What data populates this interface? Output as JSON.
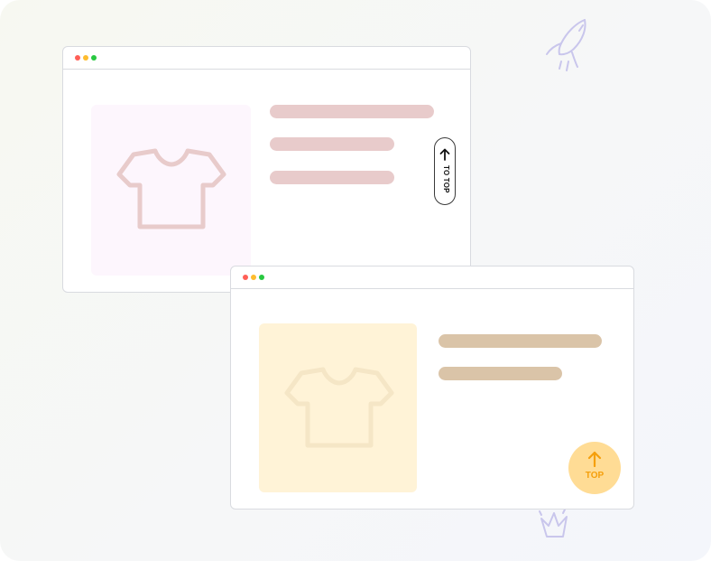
{
  "windows": [
    {
      "variant": "pill",
      "image_tint": "#fdf6fd",
      "line_color": "#e8cbcb",
      "back_to_top": {
        "label": "TO TOP",
        "icon": "arrow-up-icon"
      }
    },
    {
      "variant": "circle",
      "image_tint": "#fff3d7",
      "line_color": "#dac4a8",
      "back_to_top": {
        "label": "TOP",
        "icon": "arrow-up-icon",
        "color": "#f59f0b",
        "background": "#ffdc95"
      }
    }
  ],
  "window_controls": {
    "colors": [
      "#ff5f57",
      "#febc2e",
      "#28c840"
    ]
  },
  "decorations": [
    "rocket-doodle-icon",
    "crown-doodle-icon"
  ]
}
